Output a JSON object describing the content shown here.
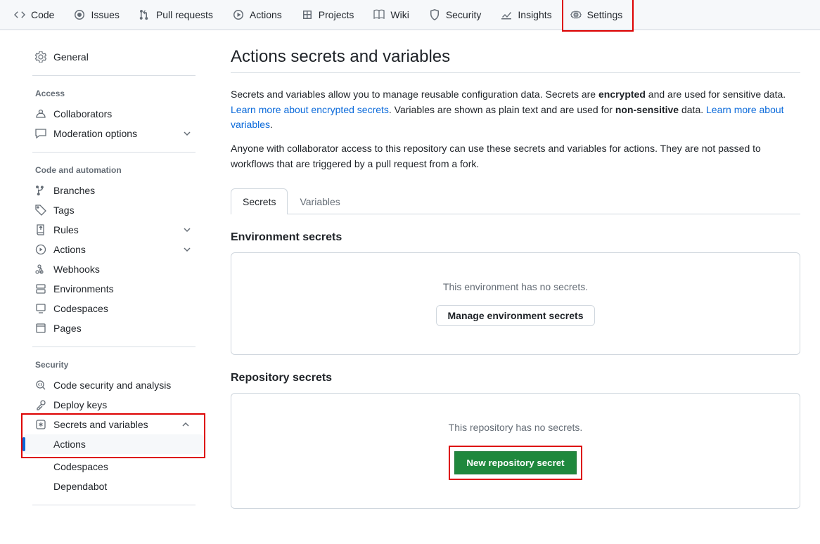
{
  "topnav": {
    "code": "Code",
    "issues": "Issues",
    "pulls": "Pull requests",
    "actions": "Actions",
    "projects": "Projects",
    "wiki": "Wiki",
    "security": "Security",
    "insights": "Insights",
    "settings": "Settings"
  },
  "sidebar": {
    "general": "General",
    "access_heading": "Access",
    "collaborators": "Collaborators",
    "moderation": "Moderation options",
    "code_heading": "Code and automation",
    "branches": "Branches",
    "tags": "Tags",
    "rules": "Rules",
    "actions": "Actions",
    "webhooks": "Webhooks",
    "environments": "Environments",
    "codespaces": "Codespaces",
    "pages": "Pages",
    "security_heading": "Security",
    "code_security": "Code security and analysis",
    "deploy_keys": "Deploy keys",
    "secrets": "Secrets and variables",
    "secrets_actions": "Actions",
    "secrets_codespaces": "Codespaces",
    "secrets_dependabot": "Dependabot"
  },
  "main": {
    "title": "Actions secrets and variables",
    "intro1a": "Secrets and variables allow you to manage reusable configuration data. Secrets are ",
    "intro1b": "encrypted",
    "intro1c": " and are used for sensitive data. ",
    "link1": "Learn more about encrypted secrets",
    "intro1d": ". Variables are shown as plain text and are used for ",
    "intro1e": "non-sensitive",
    "intro1f": " data. ",
    "link2": "Learn more about variables",
    "intro1g": ".",
    "intro2": "Anyone with collaborator access to this repository can use these secrets and variables for actions. They are not passed to workflows that are triggered by a pull request from a fork.",
    "tab_secrets": "Secrets",
    "tab_variables": "Variables",
    "env_heading": "Environment secrets",
    "env_empty": "This environment has no secrets.",
    "env_button": "Manage environment secrets",
    "repo_heading": "Repository secrets",
    "repo_empty": "This repository has no secrets.",
    "repo_button": "New repository secret"
  }
}
